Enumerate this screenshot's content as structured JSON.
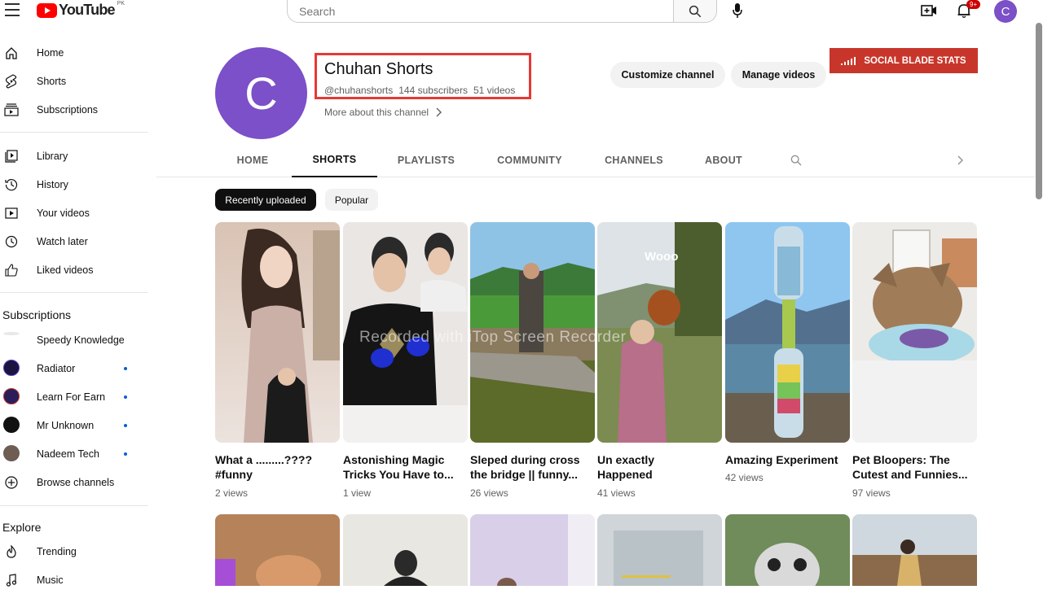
{
  "brand": {
    "logo_text": "YouTube",
    "country": "PK"
  },
  "search": {
    "placeholder": "Search"
  },
  "notifications": {
    "badge": "9+"
  },
  "user": {
    "avatar_letter": "C"
  },
  "sidebar": {
    "main": [
      {
        "label": "Home",
        "icon": "home-icon"
      },
      {
        "label": "Shorts",
        "icon": "shorts-icon"
      },
      {
        "label": "Subscriptions",
        "icon": "subscriptions-icon"
      }
    ],
    "library": [
      {
        "label": "Library",
        "icon": "library-icon"
      },
      {
        "label": "History",
        "icon": "history-icon"
      },
      {
        "label": "Your videos",
        "icon": "your-videos-icon"
      },
      {
        "label": "Watch later",
        "icon": "watch-later-icon"
      },
      {
        "label": "Liked videos",
        "icon": "liked-icon"
      }
    ],
    "subscriptions_heading": "Subscriptions",
    "subscriptions": [
      {
        "label": "Speedy Knowledge",
        "color": "#dddddd",
        "new": false
      },
      {
        "label": "Radiator",
        "color": "#1b1340",
        "new": true
      },
      {
        "label": "Learn For Earn",
        "color": "#2a1d5a",
        "new": true
      },
      {
        "label": "Mr Unknown",
        "color": "#111111",
        "new": true
      },
      {
        "label": "Nadeem Tech",
        "color": "#6d5d52",
        "new": true
      },
      {
        "label": "Browse channels",
        "color": "",
        "new": false
      }
    ],
    "explore_heading": "Explore",
    "explore": [
      {
        "label": "Trending",
        "icon": "trending-icon"
      },
      {
        "label": "Music",
        "icon": "music-icon"
      }
    ]
  },
  "channel": {
    "avatar_letter": "C",
    "name": "Chuhan Shorts",
    "handle": "@chuhanshorts",
    "subscribers": "144 subscribers",
    "videos": "51 videos",
    "more_about": "More about this channel"
  },
  "actions": {
    "customize": "Customize channel",
    "manage": "Manage videos",
    "social_blade": "SOCIAL BLADE STATS"
  },
  "tabs": [
    "HOME",
    "SHORTS",
    "PLAYLISTS",
    "COMMUNITY",
    "CHANNELS",
    "ABOUT"
  ],
  "active_tab": "SHORTS",
  "chips": [
    "Recently uploaded",
    "Popular"
  ],
  "shorts": [
    {
      "title_line1": "What a .........????",
      "title_line2": "#funny",
      "views": "2 views"
    },
    {
      "title_line1": "Astonishing Magic",
      "title_line2": "Tricks You Have to...",
      "views": "1 view"
    },
    {
      "title_line1": "Sleped during cross",
      "title_line2": "the bridge || funny...",
      "views": "26 views"
    },
    {
      "title_line1": "Un exactly",
      "title_line2": "Happened",
      "views": "41 views"
    },
    {
      "title_line1": "Amazing Experiment",
      "title_line2": "",
      "views": "42 views"
    },
    {
      "title_line1": "Pet Bloopers: The",
      "title_line2": "Cutest and Funnies...",
      "views": "97 views"
    }
  ],
  "thumb_text": {
    "wooo": "Wooo"
  },
  "watermark": "Recorded with iTop Screen Recorder",
  "colors": {
    "brand_red": "#ff0000",
    "avatar_purple": "#7b50c8",
    "social_blade": "#c8362b",
    "highlight": "#e53935"
  }
}
